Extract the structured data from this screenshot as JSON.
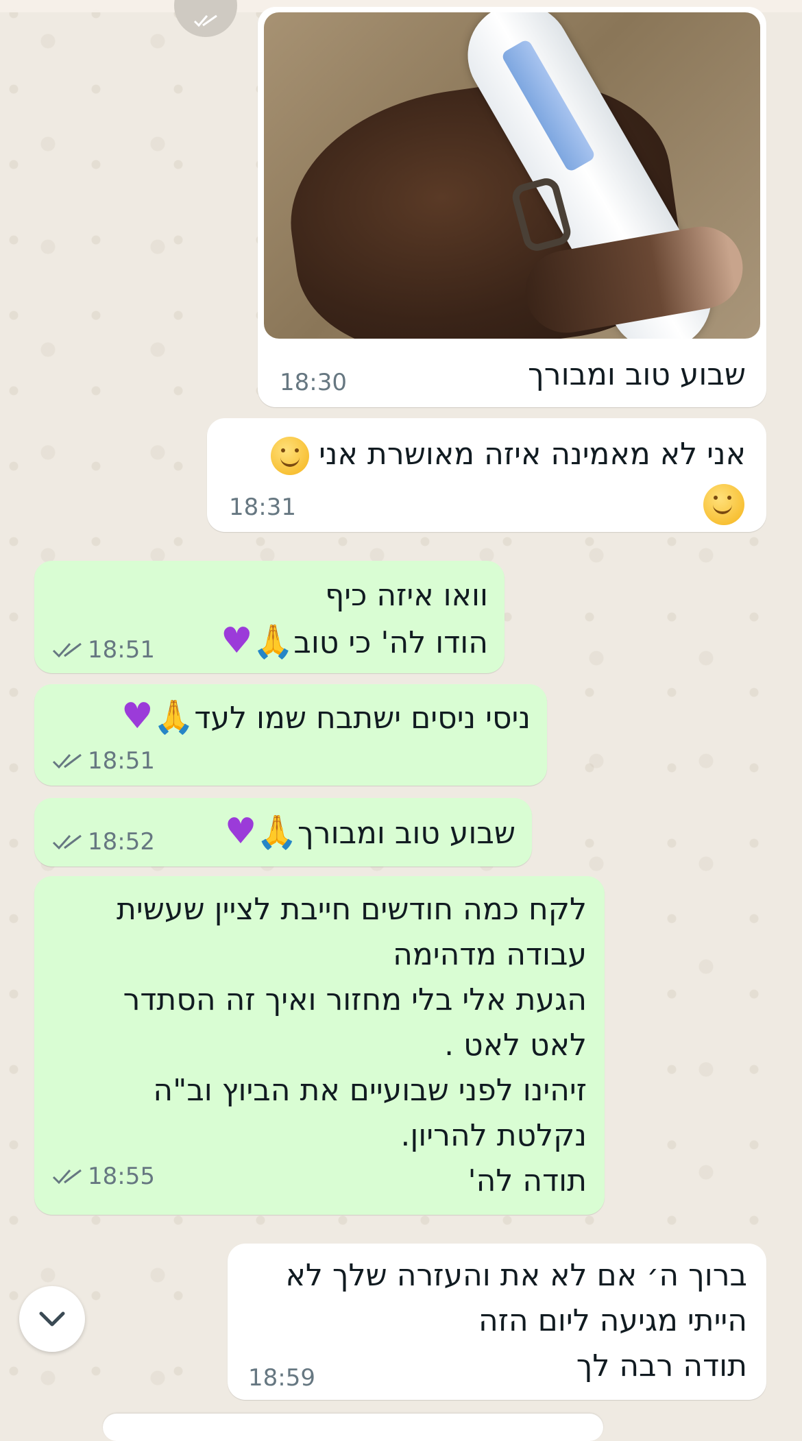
{
  "chat": {
    "messages": [
      {
        "id": "m1",
        "direction": "incoming",
        "type": "image",
        "caption": "שבוע טוב ומבורך",
        "time": "18:30"
      },
      {
        "id": "m2",
        "direction": "incoming",
        "text_line1": "אני לא מאמינה איזה מאושרת אני",
        "time": "18:31"
      },
      {
        "id": "m3",
        "direction": "outgoing",
        "text_line1": "וואו איזה כיף",
        "text_line2": "הודו לה' כי טוב",
        "time": "18:51",
        "status": "read"
      },
      {
        "id": "m4",
        "direction": "outgoing",
        "text_line1": "ניסי ניסים ישתבח שמו לעד",
        "time": "18:51",
        "status": "read"
      },
      {
        "id": "m5",
        "direction": "outgoing",
        "text_line1": "שבוע טוב ומבורך",
        "time": "18:52",
        "status": "read"
      },
      {
        "id": "m6",
        "direction": "outgoing",
        "text": "לקח כמה חודשים חייבת לציין שעשית\nעבודה מדהימה\nהגעת אלי בלי מחזור ואיך זה הסתדר\nלאט לאט .\nזיהינו לפני שבועיים את הביוץ וב\"ה\nנקלטת להריון.\nתודה לה'",
        "time": "18:55",
        "status": "read"
      },
      {
        "id": "m7",
        "direction": "incoming",
        "text": "ברוך ה׳ אם לא את והעזרה שלך לא\nהייתי מגיעה ליום הזה\nתודה רבה לך",
        "time": "18:59"
      }
    ]
  },
  "icons": {
    "read_receipt": "double-check-icon",
    "scroll_down": "chevron-down-icon",
    "heart": "purple-heart-icon",
    "pray": "folded-hands-icon",
    "smile": "smiling-face-icon"
  },
  "colors": {
    "background": "#efeae2",
    "incoming_bubble": "#ffffff",
    "outgoing_bubble": "#d9fdd3",
    "meta_text": "#667781"
  }
}
